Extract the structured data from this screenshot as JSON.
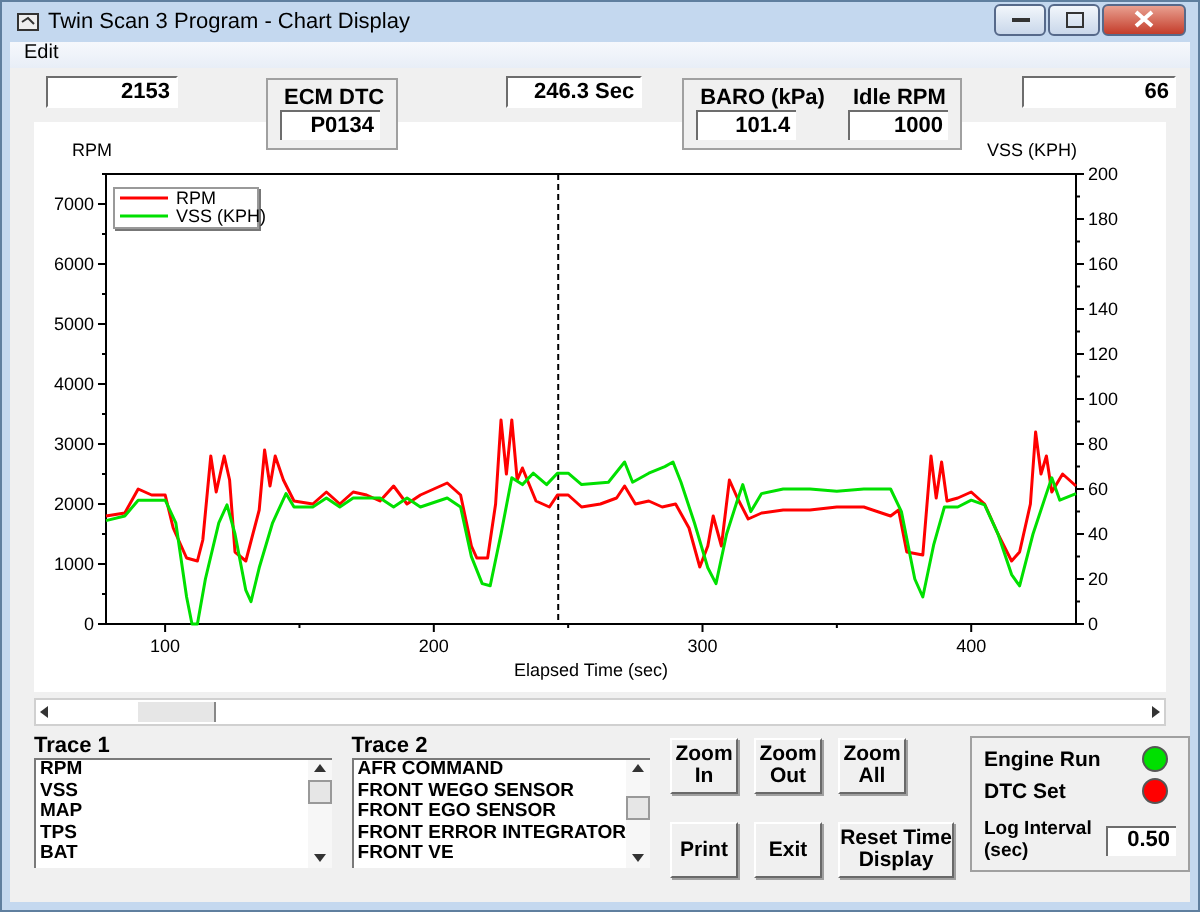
{
  "window": {
    "title": "Twin Scan 3 Program - Chart Display"
  },
  "menu": [
    "Edit"
  ],
  "readouts": [
    {
      "kind": "field",
      "value": "2153"
    },
    {
      "kind": "group",
      "fields": [
        {
          "label": "ECM DTC",
          "value": "P0134"
        }
      ]
    },
    {
      "kind": "field",
      "value": "246.3 Sec"
    },
    {
      "kind": "group",
      "fields": [
        {
          "label": "BARO (kPa)",
          "value": "101.4"
        },
        {
          "label": "Idle RPM",
          "value": "1000"
        }
      ]
    },
    {
      "kind": "field",
      "value": "66"
    }
  ],
  "chart": {
    "chart_data": {
      "type": "line",
      "xlabel": "Elapsed Time (sec)",
      "ylabel": "RPM",
      "y2label": "VSS (KPH)",
      "xlim": [
        78,
        439
      ],
      "ylim": [
        0,
        7500
      ],
      "y2lim": [
        0,
        200
      ],
      "xticks": [
        100,
        200,
        300,
        400
      ],
      "yticks": [
        0,
        1000,
        2000,
        3000,
        4000,
        5000,
        6000,
        7000
      ],
      "y2ticks": [
        0,
        20,
        40,
        60,
        80,
        100,
        120,
        140,
        160,
        180,
        200
      ],
      "ref_lines": [
        {
          "axis": "x",
          "value": 246.3
        }
      ],
      "legend": true,
      "series": [
        {
          "name": "RPM",
          "color": "#ff0000",
          "x": [
            78,
            85,
            90,
            95,
            100,
            103,
            108,
            112,
            114,
            117,
            119,
            122,
            124,
            126,
            130,
            135,
            137,
            139,
            141,
            144,
            148,
            155,
            160,
            165,
            170,
            175,
            180,
            185,
            190,
            195,
            205,
            210,
            214,
            216,
            220,
            223,
            225,
            227,
            229,
            231,
            233,
            238,
            243,
            246,
            250,
            255,
            262,
            268,
            271,
            275,
            280,
            285,
            290,
            295,
            299,
            302,
            304,
            307,
            310,
            313,
            317,
            322,
            330,
            340,
            350,
            360,
            370,
            373,
            376,
            382,
            385,
            387,
            389,
            391,
            395,
            400,
            405,
            410,
            415,
            418,
            422,
            424,
            426,
            428,
            430,
            434,
            439
          ],
          "values": [
            1800,
            1850,
            2250,
            2150,
            2150,
            1600,
            1100,
            1050,
            1400,
            2800,
            2200,
            2800,
            2400,
            1200,
            1050,
            1900,
            2900,
            2300,
            2800,
            2400,
            2050,
            2000,
            2200,
            2000,
            2200,
            2150,
            2050,
            2300,
            2000,
            2150,
            2350,
            2150,
            1300,
            1100,
            1100,
            2000,
            3400,
            2500,
            3400,
            2400,
            2600,
            2050,
            1950,
            2150,
            2150,
            1950,
            2000,
            2100,
            2300,
            2000,
            2050,
            1950,
            2000,
            1600,
            950,
            1300,
            1800,
            1300,
            2400,
            2100,
            1750,
            1850,
            1900,
            1900,
            1950,
            1950,
            1800,
            1900,
            1200,
            1150,
            2800,
            2100,
            2700,
            2050,
            2100,
            2200,
            2000,
            1500,
            1050,
            1200,
            2000,
            3200,
            2500,
            2800,
            2200,
            2500,
            2300
          ]
        },
        {
          "name": "VSS (KPH)",
          "color": "#00e000",
          "axis": "y2",
          "x": [
            78,
            85,
            90,
            100,
            104,
            108,
            110,
            112,
            115,
            120,
            123,
            126,
            130,
            132,
            135,
            140,
            145,
            148,
            155,
            160,
            165,
            170,
            180,
            185,
            190,
            195,
            205,
            210,
            214,
            218,
            221,
            225,
            229,
            233,
            237,
            242,
            246,
            250,
            255,
            265,
            271,
            274,
            280,
            286,
            289,
            292,
            297,
            302,
            305,
            309,
            313,
            315,
            318,
            322,
            330,
            340,
            350,
            360,
            370,
            374,
            379,
            382,
            386,
            390,
            395,
            400,
            405,
            410,
            415,
            418,
            423,
            428,
            430,
            433,
            439
          ],
          "values": [
            46,
            48,
            55,
            55,
            45,
            12,
            0,
            0,
            20,
            45,
            53,
            40,
            15,
            10,
            25,
            45,
            58,
            52,
            52,
            56,
            52,
            56,
            56,
            52,
            56,
            52,
            56,
            52,
            30,
            18,
            17,
            40,
            65,
            62,
            67,
            62,
            67,
            67,
            62,
            63,
            72,
            63,
            67,
            70,
            72,
            63,
            45,
            25,
            18,
            40,
            55,
            62,
            50,
            58,
            60,
            60,
            59,
            60,
            60,
            50,
            20,
            12,
            35,
            52,
            52,
            55,
            53,
            40,
            22,
            17,
            40,
            58,
            65,
            55,
            58
          ]
        }
      ]
    }
  },
  "traces": [
    {
      "label": "Trace 1",
      "items": [
        "RPM",
        "VSS",
        "MAP",
        "TPS",
        "BAT"
      ]
    },
    {
      "label": "Trace 2",
      "items": [
        "AFR COMMAND",
        "FRONT WEGO SENSOR",
        "FRONT EGO SENSOR",
        "FRONT ERROR INTEGRATOR",
        "FRONT VE"
      ]
    }
  ],
  "buttons": [
    {
      "label": "Zoom In",
      "kind": "small"
    },
    {
      "label": "Zoom Out",
      "kind": "small"
    },
    {
      "label": "Zoom All",
      "kind": "small"
    },
    {
      "label": "Print",
      "kind": "small"
    },
    {
      "label": "Exit",
      "kind": "small"
    },
    {
      "label": "Reset Time Display",
      "kind": "wide"
    }
  ],
  "status": {
    "indicators": [
      {
        "label": "Engine Run",
        "color": "#00e000"
      },
      {
        "label": "DTC Set",
        "color": "#ff0000"
      }
    ],
    "log_interval": {
      "label": "Log Interval (sec)",
      "value": "0.50"
    }
  }
}
